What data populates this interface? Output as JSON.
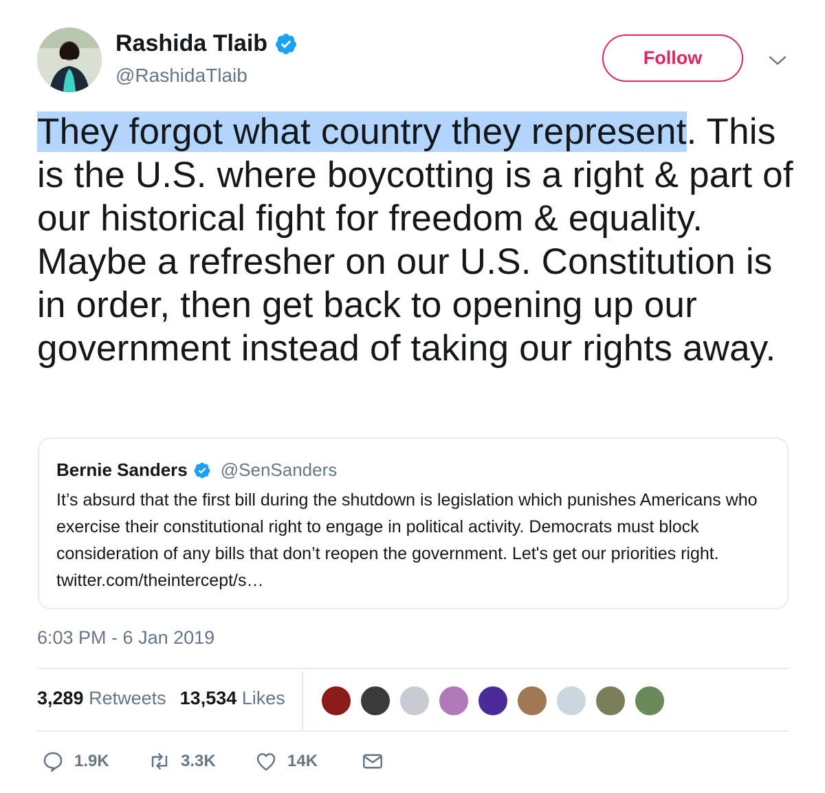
{
  "author": {
    "name": "Rashida Tlaib",
    "handle": "@RashidaTlaib"
  },
  "follow_label": "Follow",
  "tweet": {
    "highlighted": "They forgot what country they represent",
    "rest": ". This is the U.S. where boycotting is a right & part of our historical fight for freedom & equality. Maybe a refresher on our U.S. Constitution is in order, then get back to opening up our government instead of taking our rights away."
  },
  "quote": {
    "name": "Bernie Sanders",
    "handle": "@SenSanders",
    "text": "It’s absurd that the first bill during the shutdown is legislation which punishes Americans who exercise their constitutional right to engage in political activity. Democrats must block consideration of any bills that don’t reopen the government. Let's get our priorities right. twitter.com/theintercept/s…"
  },
  "timestamp": "6:03 PM - 6 Jan 2019",
  "stats": {
    "retweets_count": "3,289",
    "retweets_label": "Retweets",
    "likes_count": "13,534",
    "likes_label": "Likes"
  },
  "liker_avatars": [
    "#8b1a1a",
    "#3a3a3a",
    "#c8ccd0",
    "#b07ab8",
    "#4b2a9a",
    "#a07855",
    "#ccd6dd",
    "#7a7f5a",
    "#6a8a5a"
  ],
  "actions": {
    "reply_count": "1.9K",
    "retweet_count": "3.3K",
    "like_count": "14K"
  },
  "colors": {
    "follow_accent": "#e0245e",
    "secondary_text": "#657786",
    "verified_blue": "#1da1f2",
    "selection_highlight": "#b3d4fc"
  }
}
